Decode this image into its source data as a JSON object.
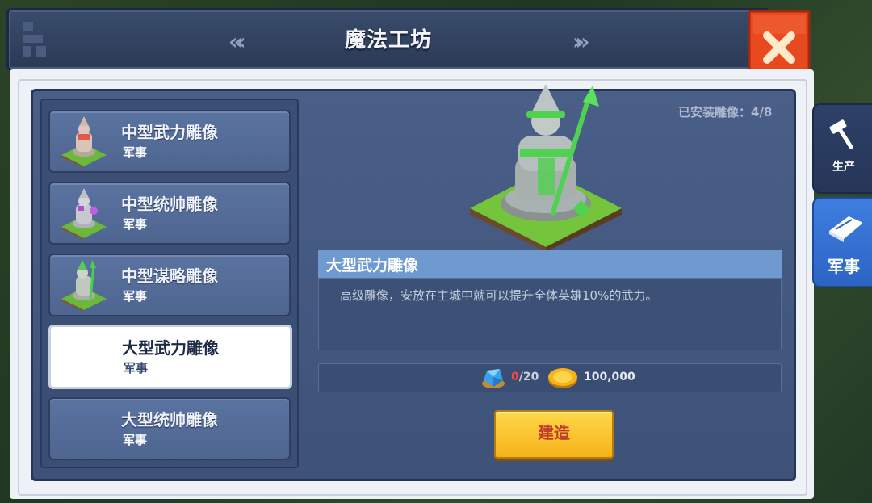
{
  "window": {
    "title": "魔法工坊",
    "installed_label": "已安装雕像：4/8"
  },
  "list": {
    "items": [
      {
        "name": "中型武力雕像",
        "category": "军事",
        "icon": "medium-force-statue-icon"
      },
      {
        "name": "中型统帅雕像",
        "category": "军事",
        "icon": "medium-command-statue-icon"
      },
      {
        "name": "中型谋略雕像",
        "category": "军事",
        "icon": "medium-strategy-statue-icon"
      },
      {
        "name": "大型武力雕像",
        "category": "军事",
        "icon": ""
      },
      {
        "name": "大型统帅雕像",
        "category": "军事",
        "icon": ""
      }
    ],
    "selected_index": 3
  },
  "detail": {
    "title": "大型武力雕像",
    "description": "高级雕像，安放在主城中就可以提升全体英雄10%的武力。",
    "cost": {
      "gem_current": "0",
      "gem_required": "/20",
      "gold": "100,000"
    },
    "build_label": "建造"
  },
  "side_tabs": [
    {
      "label": "生产",
      "icon": "hammer-icon",
      "active": false
    },
    {
      "label": "军事",
      "icon": "book-icon",
      "active": true
    }
  ],
  "colors": {
    "panel": "#44587f",
    "desc_header": "#6e9ad0",
    "build_button": "#f9c62e",
    "close_button": "#e8491f",
    "active_tab": "#3a78da"
  }
}
